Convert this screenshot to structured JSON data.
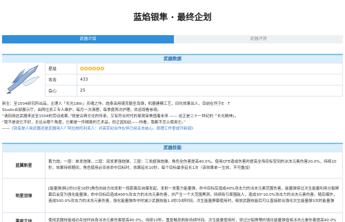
{
  "page": {
    "title": "蓝焰银隼 · 最终企划"
  },
  "tabs": [
    {
      "label": "武器介绍",
      "active": true
    },
    {
      "label": "武器评测",
      "active": false
    }
  ],
  "weapon_data": {
    "header": "武器数据",
    "image_icon": "weapon-illustration",
    "rows": [
      {
        "key": "星级",
        "stars": 6
      },
      {
        "key": "攻击",
        "value": "433"
      },
      {
        "key": "会心",
        "value": "25"
      }
    ]
  },
  "description": {
    "lines": [
      "新生：至1504研究所出品，主理人「长光18th」灵魂之作。炮身采用德克勒圣岛钢，机器建模工艺，旧化效果出人，目前在列于E · T",
      "Studio合部展示厅，由两位员工专人维护，每月一次清理，每季度两次护理。欢迎观看参观。",
      "“请别用这武器来这至1504的劳动成果。”既是古典文化的传承，又有符合时代的易观审美值着未来 —— 这正是二十一世纪的「长光精神」。",
      "“我不是说它不好，无论从哪个角度，它都是一件精致的艺术品，但正因如此——你看，我都不怎么使用它。”",
      "——《到底是人用武器还是武器用人？阿拉她托利亚人：对高军纪合作伙伴已经关去结心。原理工作室成开新闻》"
    ],
    "accent_segment": "《到底是人用武器还是武器用人？阿拉她托利亚人：对高军纪合作伙伴已经关去结心。原理工作室成开新闻》"
  },
  "weapon_skills": {
    "header": "武器技能",
    "skills": [
      {
        "name": "蓝翼新星",
        "text": "蓄力炮，一层：单发炮弹，二层：双发更强炮弹，三层：三发超强炮弹。角色全伤害提高40.0%。使用QTE造成伤害时提高全场目标受到的冰冻元素伤害20.0%，持续10秒，效果持续期间，角色使用必杀技命中目标时，效果延长10秒，每个目标最多延长1次（该效果单一生效，不可叠加）"
      },
      {
        "name": "明星羽弹",
        "text": "[能量弹]耗1秒[0至16秒]角色向前方向发射一段距离后自爆发起，发射一发蓄力能量弹，命中目标后造成40%攻击力的冰冻元素范围伤害，能量弹穿过次生能量利用分裂屏幕后会变为强化能量弹，命中目标后造成400%攻击力的冰冻元素伤害，并产生一个大范围黑洞，持续吸引周围敌人，造成30*10.0%攻击力的冰冻元素伤害。随后爆炸，造成500.0%攻击力的冰冻元素伤害，强化能量弹命中时减少武器技能1.0秒冷却时间。次生能量屏幕使用时，释放武器技能后可以直接射出强化次生能量弹3次的能量弹"
      },
      {
        "name": "零度立场",
        "text": "使用武器技能或必杀技时自身冰冻元素伤害提高40.0%，持续10秒。重复触发刷新持续时间。次生能量使用时，穿过分裂屏障的强化能量弹造成冰冻元素伤害提高40.0%"
      }
    ]
  },
  "colors": {
    "accent": "#2f8fd8",
    "section_header_bg": "#dbeefb",
    "section_border": "#7ec2ec",
    "star": "#f5a300",
    "link": "#3179c8"
  }
}
